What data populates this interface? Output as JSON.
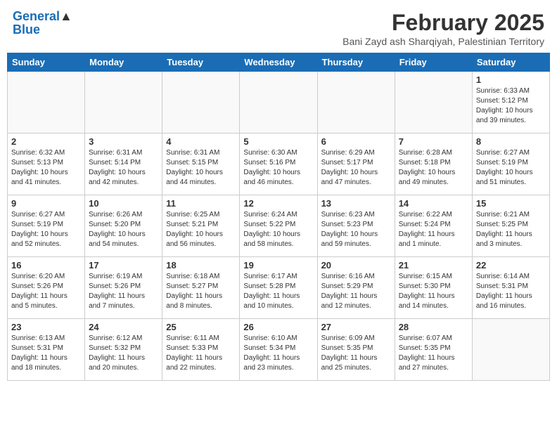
{
  "header": {
    "logo_line1": "General",
    "logo_line2": "Blue",
    "main_title": "February 2025",
    "subtitle": "Bani Zayd ash Sharqiyah, Palestinian Territory"
  },
  "weekdays": [
    "Sunday",
    "Monday",
    "Tuesday",
    "Wednesday",
    "Thursday",
    "Friday",
    "Saturday"
  ],
  "weeks": [
    [
      {
        "day": "",
        "info": ""
      },
      {
        "day": "",
        "info": ""
      },
      {
        "day": "",
        "info": ""
      },
      {
        "day": "",
        "info": ""
      },
      {
        "day": "",
        "info": ""
      },
      {
        "day": "",
        "info": ""
      },
      {
        "day": "1",
        "info": "Sunrise: 6:33 AM\nSunset: 5:12 PM\nDaylight: 10 hours and 39 minutes."
      }
    ],
    [
      {
        "day": "2",
        "info": "Sunrise: 6:32 AM\nSunset: 5:13 PM\nDaylight: 10 hours and 41 minutes."
      },
      {
        "day": "3",
        "info": "Sunrise: 6:31 AM\nSunset: 5:14 PM\nDaylight: 10 hours and 42 minutes."
      },
      {
        "day": "4",
        "info": "Sunrise: 6:31 AM\nSunset: 5:15 PM\nDaylight: 10 hours and 44 minutes."
      },
      {
        "day": "5",
        "info": "Sunrise: 6:30 AM\nSunset: 5:16 PM\nDaylight: 10 hours and 46 minutes."
      },
      {
        "day": "6",
        "info": "Sunrise: 6:29 AM\nSunset: 5:17 PM\nDaylight: 10 hours and 47 minutes."
      },
      {
        "day": "7",
        "info": "Sunrise: 6:28 AM\nSunset: 5:18 PM\nDaylight: 10 hours and 49 minutes."
      },
      {
        "day": "8",
        "info": "Sunrise: 6:27 AM\nSunset: 5:19 PM\nDaylight: 10 hours and 51 minutes."
      }
    ],
    [
      {
        "day": "9",
        "info": "Sunrise: 6:27 AM\nSunset: 5:19 PM\nDaylight: 10 hours and 52 minutes."
      },
      {
        "day": "10",
        "info": "Sunrise: 6:26 AM\nSunset: 5:20 PM\nDaylight: 10 hours and 54 minutes."
      },
      {
        "day": "11",
        "info": "Sunrise: 6:25 AM\nSunset: 5:21 PM\nDaylight: 10 hours and 56 minutes."
      },
      {
        "day": "12",
        "info": "Sunrise: 6:24 AM\nSunset: 5:22 PM\nDaylight: 10 hours and 58 minutes."
      },
      {
        "day": "13",
        "info": "Sunrise: 6:23 AM\nSunset: 5:23 PM\nDaylight: 10 hours and 59 minutes."
      },
      {
        "day": "14",
        "info": "Sunrise: 6:22 AM\nSunset: 5:24 PM\nDaylight: 11 hours and 1 minute."
      },
      {
        "day": "15",
        "info": "Sunrise: 6:21 AM\nSunset: 5:25 PM\nDaylight: 11 hours and 3 minutes."
      }
    ],
    [
      {
        "day": "16",
        "info": "Sunrise: 6:20 AM\nSunset: 5:26 PM\nDaylight: 11 hours and 5 minutes."
      },
      {
        "day": "17",
        "info": "Sunrise: 6:19 AM\nSunset: 5:26 PM\nDaylight: 11 hours and 7 minutes."
      },
      {
        "day": "18",
        "info": "Sunrise: 6:18 AM\nSunset: 5:27 PM\nDaylight: 11 hours and 8 minutes."
      },
      {
        "day": "19",
        "info": "Sunrise: 6:17 AM\nSunset: 5:28 PM\nDaylight: 11 hours and 10 minutes."
      },
      {
        "day": "20",
        "info": "Sunrise: 6:16 AM\nSunset: 5:29 PM\nDaylight: 11 hours and 12 minutes."
      },
      {
        "day": "21",
        "info": "Sunrise: 6:15 AM\nSunset: 5:30 PM\nDaylight: 11 hours and 14 minutes."
      },
      {
        "day": "22",
        "info": "Sunrise: 6:14 AM\nSunset: 5:31 PM\nDaylight: 11 hours and 16 minutes."
      }
    ],
    [
      {
        "day": "23",
        "info": "Sunrise: 6:13 AM\nSunset: 5:31 PM\nDaylight: 11 hours and 18 minutes."
      },
      {
        "day": "24",
        "info": "Sunrise: 6:12 AM\nSunset: 5:32 PM\nDaylight: 11 hours and 20 minutes."
      },
      {
        "day": "25",
        "info": "Sunrise: 6:11 AM\nSunset: 5:33 PM\nDaylight: 11 hours and 22 minutes."
      },
      {
        "day": "26",
        "info": "Sunrise: 6:10 AM\nSunset: 5:34 PM\nDaylight: 11 hours and 23 minutes."
      },
      {
        "day": "27",
        "info": "Sunrise: 6:09 AM\nSunset: 5:35 PM\nDaylight: 11 hours and 25 minutes."
      },
      {
        "day": "28",
        "info": "Sunrise: 6:07 AM\nSunset: 5:35 PM\nDaylight: 11 hours and 27 minutes."
      },
      {
        "day": "",
        "info": ""
      }
    ]
  ]
}
